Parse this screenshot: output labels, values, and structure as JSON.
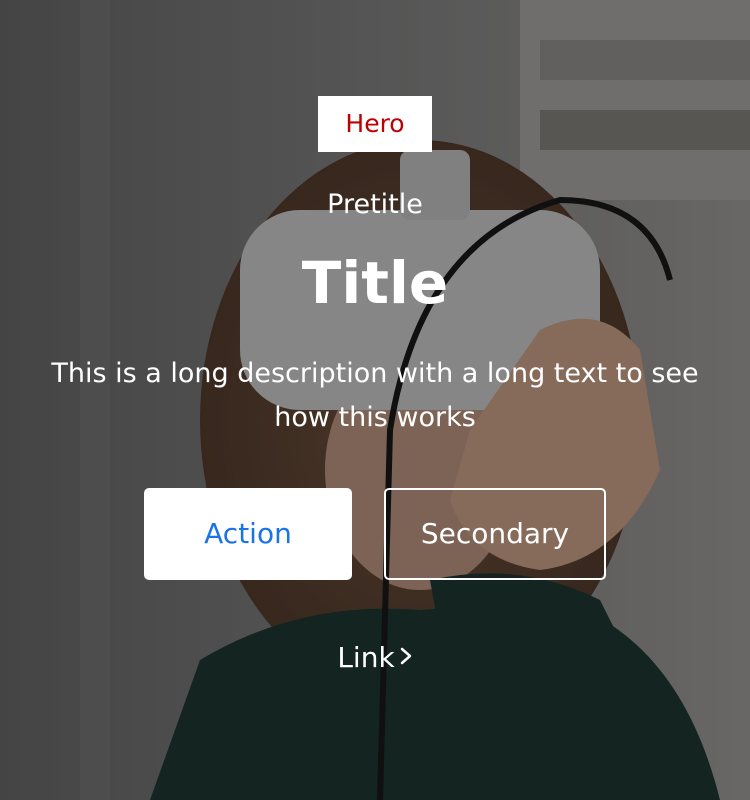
{
  "hero": {
    "badge": "Hero",
    "pretitle": "Pretitle",
    "title": "Title",
    "description": "This is a long description with a long text to see how this works",
    "primary_action": "Action",
    "secondary_action": "Secondary",
    "link": "Link",
    "link_icon": "chevron-right-icon"
  },
  "colors": {
    "badge_text": "#c00000",
    "primary_button_text": "#1a73e8",
    "text": "#ffffff"
  }
}
